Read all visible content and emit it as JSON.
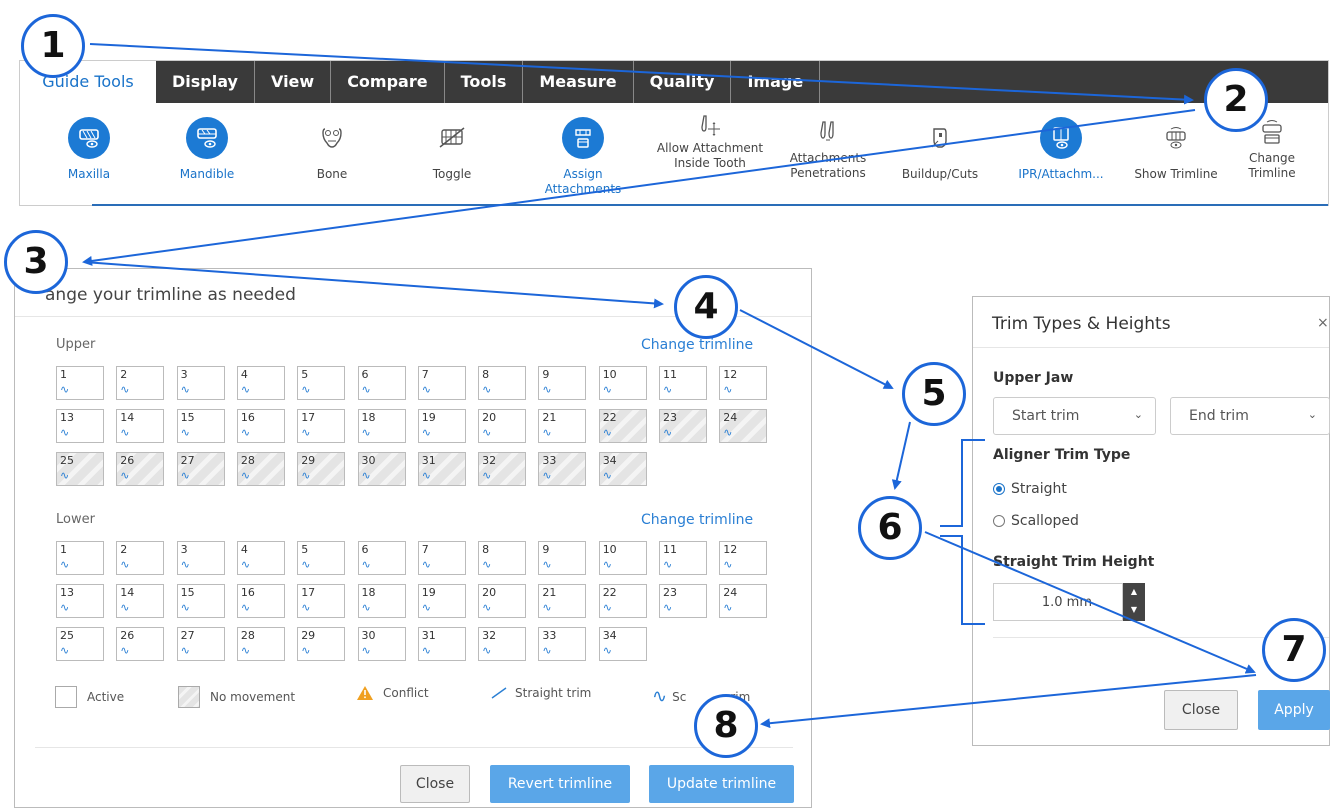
{
  "toolbar": {
    "tabs": [
      "Guide Tools",
      "Display",
      "View",
      "Compare",
      "Tools",
      "Measure",
      "Quality",
      "Image"
    ],
    "tools": [
      {
        "label": "Maxilla",
        "icon": "maxilla-eye-icon",
        "active": true
      },
      {
        "label": "Mandible",
        "icon": "mandible-eye-icon",
        "active": true
      },
      {
        "label": "Bone",
        "icon": "bone-icon",
        "active": false
      },
      {
        "label": "Toggle",
        "icon": "toggle-icon",
        "active": false
      },
      {
        "label": "Assign Attachments",
        "icon": "assign-attachments-icon",
        "active": true
      },
      {
        "label": "Allow Attachment Inside Tooth",
        "icon": "allow-attachment-icon",
        "active": false
      },
      {
        "label": "Attachments Penetrations",
        "icon": "attachments-penetrations-icon",
        "active": false
      },
      {
        "label": "Buildup/Cuts",
        "icon": "buildup-cuts-icon",
        "active": false
      },
      {
        "label": "IPR/Attachm...",
        "icon": "ipr-attachments-icon",
        "active": true
      },
      {
        "label": "Show Trimline",
        "icon": "show-trimline-icon",
        "active": false
      },
      {
        "label": "Change Trimline",
        "icon": "change-trimline-icon",
        "active": false
      }
    ]
  },
  "trimline_panel": {
    "title": "ange your trimline as needed",
    "upper": {
      "label": "Upper",
      "link": "Change trimline",
      "teeth": [
        "1",
        "2",
        "3",
        "4",
        "5",
        "6",
        "7",
        "8",
        "9",
        "10",
        "11",
        "12",
        "13",
        "14",
        "15",
        "16",
        "17",
        "18",
        "19",
        "20",
        "21",
        "22",
        "23",
        "24",
        "25",
        "26",
        "27",
        "28",
        "29",
        "30",
        "31",
        "32",
        "33",
        "34"
      ],
      "no_movement": [
        "22",
        "23",
        "24",
        "25",
        "26",
        "27",
        "28",
        "29",
        "30",
        "31",
        "32",
        "33",
        "34"
      ]
    },
    "lower": {
      "label": "Lower",
      "link": "Change trimline",
      "teeth": [
        "1",
        "2",
        "3",
        "4",
        "5",
        "6",
        "7",
        "8",
        "9",
        "10",
        "11",
        "12",
        "13",
        "14",
        "15",
        "16",
        "17",
        "18",
        "19",
        "20",
        "21",
        "22",
        "23",
        "24",
        "25",
        "26",
        "27",
        "28",
        "29",
        "30",
        "31",
        "32",
        "33",
        "34"
      ],
      "no_movement": []
    },
    "wave_glyph": "∿",
    "legend": {
      "active": "Active",
      "no_movement": "No movement",
      "conflict": "Conflict",
      "straight": "Straight trim",
      "scalloped_visible": "Sc",
      "scalloped_tail": "rim"
    },
    "buttons": {
      "close": "Close",
      "revert": "Revert trimline",
      "update": "Update trimline"
    }
  },
  "types_panel": {
    "title": "Trim Types & Heights",
    "close_glyph": "×",
    "upper_jaw": "Upper Jaw",
    "start_trim": "Start trim",
    "end_trim": "End trim",
    "aligner_trim_type": "Aligner Trim Type",
    "straight": "Straight",
    "scalloped": "Scalloped",
    "selected": "Straight",
    "height_label": "Straight Trim Height",
    "height_value": "1.0 mm",
    "buttons": {
      "close": "Close",
      "apply": "Apply"
    }
  },
  "callouts": [
    "1",
    "2",
    "3",
    "4",
    "5",
    "6",
    "7",
    "8"
  ],
  "colors": {
    "accent": "#1c7ad4",
    "callout": "#1c66d9",
    "primary_button": "#5aa6e8",
    "tab_bar": "#3a3a3a"
  }
}
